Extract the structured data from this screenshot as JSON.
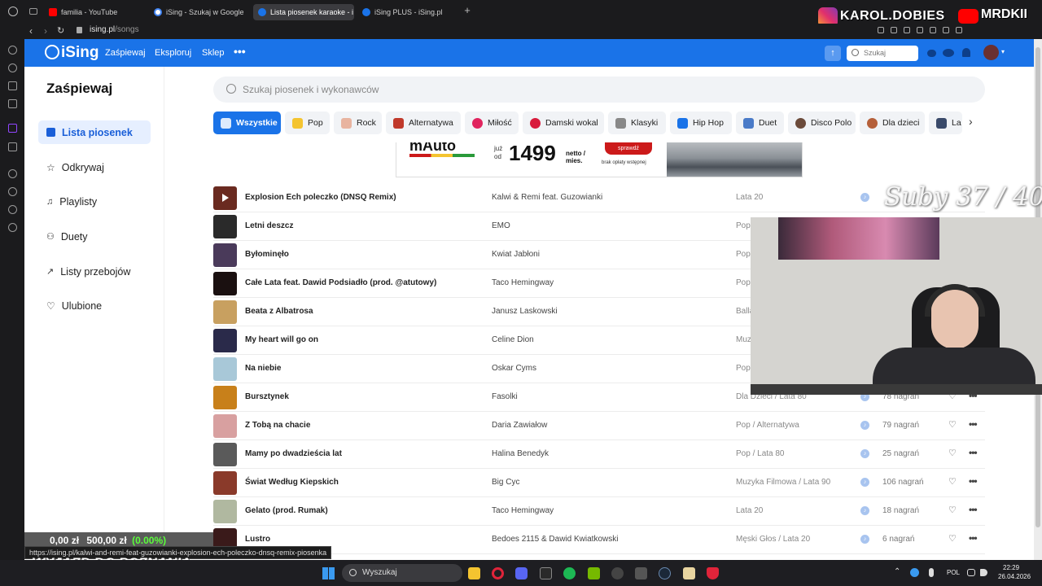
{
  "browser": {
    "tabs": [
      {
        "label": "familia - YouTube",
        "color": "#ff0000"
      },
      {
        "label": "iSing - Szukaj w Google",
        "color": "#4285f4"
      },
      {
        "label": "Lista piosenek karaoke - i",
        "color": "#1a73e8"
      },
      {
        "label": "iSing PLUS - iSing.pl",
        "color": "#1a73e8"
      }
    ],
    "url": "ising.pl/songs",
    "url_domain": "ising.pl",
    "url_path": "/songs"
  },
  "overlay": {
    "instagram_handle": "KAROL.DOBIES",
    "youtube_handle": "MRDKII",
    "subs_counter": "Suby 37 / 40",
    "donation_text_left": "0,00 zł",
    "donation_text_right": "500,00 zł",
    "donation_percent": "(0.00%)",
    "donation_progress": 0,
    "banner_text": "WYJAZD DO POZNANIA",
    "status_link": "https://ising.pl/kalwi-and-remi-feat-guzowianki-explosion-ech-poleczko-dnsq-remix-piosenka"
  },
  "header": {
    "logo": "iSing",
    "nav": [
      "Zaśpiewaj",
      "Eksploruj",
      "Sklep"
    ],
    "search_placeholder": "Szukaj"
  },
  "sidebar": {
    "title": "Zaśpiewaj",
    "items": [
      {
        "label": "Lista piosenek",
        "icon": "list-icon",
        "active": true
      },
      {
        "label": "Odkrywaj",
        "icon": "star-icon",
        "active": false
      },
      {
        "label": "Playlisty",
        "icon": "playlist-icon",
        "active": false
      },
      {
        "label": "Duety",
        "icon": "people-icon",
        "active": false
      },
      {
        "label": "Listy przebojów",
        "icon": "trend-icon",
        "active": false
      },
      {
        "label": "Ulubione",
        "icon": "heart-icon",
        "active": false
      }
    ]
  },
  "main": {
    "search_placeholder": "Szukaj piosenek i wykonawców",
    "categories": [
      {
        "label": "Wszystkie",
        "color": "#ffffff",
        "active": true
      },
      {
        "label": "Pop",
        "color": "#f4c430",
        "active": false
      },
      {
        "label": "Rock",
        "color": "#e8b4a0",
        "active": false
      },
      {
        "label": "Alternatywa",
        "color": "#c0392b",
        "active": false
      },
      {
        "label": "Miłość",
        "color": "#e0245e",
        "active": false
      },
      {
        "label": "Damski wokal",
        "color": "#d81b3c",
        "active": false
      },
      {
        "label": "Klasyki",
        "color": "#888888",
        "active": false
      },
      {
        "label": "Hip Hop",
        "color": "#1a73e8",
        "active": false
      },
      {
        "label": "Duet",
        "color": "#4a7bc8",
        "active": false
      },
      {
        "label": "Disco Polo",
        "color": "#6b4a3a",
        "active": false
      },
      {
        "label": "Dla dzieci",
        "color": "#b5603a",
        "active": false
      },
      {
        "label": "La",
        "color": "#3a4a6a",
        "active": false
      }
    ],
    "ad": {
      "brand": "mAuto",
      "prefix": "już od",
      "price": "1499",
      "suffix": "netto / mies.",
      "cta": "sprawdź",
      "note": "brak opłaty wstępnej"
    },
    "songs": [
      {
        "title": "Explosion Ech poleczko (DNSQ Remix)",
        "artist": "Kalwi & Remi feat. Guzowianki",
        "genre": "Lata 20",
        "count": "",
        "thumb": "#6a2a20"
      },
      {
        "title": "Letni deszcz",
        "artist": "EMO",
        "genre": "Pop",
        "count": "",
        "thumb": "#2a2a2a"
      },
      {
        "title": "Byłominęło",
        "artist": "Kwiat Jabłoni",
        "genre": "Pop",
        "count": "",
        "thumb": "#4a3a5a"
      },
      {
        "title": "Całe Lata feat. Dawid Podsiadło (prod. @atutowy)",
        "artist": "Taco Hemingway",
        "genre": "Pop",
        "count": "",
        "thumb": "#1a1010"
      },
      {
        "title": "Beata z Albatrosa",
        "artist": "Janusz Laskowski",
        "genre": "Ballad",
        "count": "",
        "thumb": "#c8a060"
      },
      {
        "title": "My heart will go on",
        "artist": "Celine Dion",
        "genre": "Muz",
        "count": "",
        "thumb": "#2a2a4a"
      },
      {
        "title": "Na niebie",
        "artist": "Oskar Cyms",
        "genre": "Pop",
        "count": "",
        "thumb": "#a8c8d8"
      },
      {
        "title": "Bursztynek",
        "artist": "Fasolki",
        "genre": "Dla Dzieci / Lata 80",
        "count": "78 nagrań",
        "thumb": "#c8801a"
      },
      {
        "title": "Z Tobą na chacie",
        "artist": "Daria Zawiałow",
        "genre": "Pop / Alternatywa",
        "count": "79 nagrań",
        "thumb": "#d8a0a0"
      },
      {
        "title": "Mamy po dwadzieścia lat",
        "artist": "Halina Benedyk",
        "genre": "Pop / Lata 80",
        "count": "25 nagrań",
        "thumb": "#5a5a5a"
      },
      {
        "title": "Świat Według Kiepskich",
        "artist": "Big Cyc",
        "genre": "Muzyka Filmowa / Lata 90",
        "count": "106 nagrań",
        "thumb": "#8a3a2a"
      },
      {
        "title": "Gelato (prod. Rumak)",
        "artist": "Taco Hemingway",
        "genre": "Lata 20",
        "count": "18 nagrań",
        "thumb": "#b0b8a0"
      },
      {
        "title": "Lustro",
        "artist": "Bedoes 2115 & Dawid Kwiatkowski",
        "genre": "Męski Głos / Lata 20",
        "count": "6 nagrań",
        "thumb": "#3a1a1a"
      }
    ]
  },
  "taskbar": {
    "search_placeholder": "Wyszukaj",
    "lang": "POL",
    "time": "22:29",
    "date": "26.04.2026"
  },
  "colors": {
    "brand_blue": "#1a73e8",
    "ad_red": "#cc1a1a"
  }
}
